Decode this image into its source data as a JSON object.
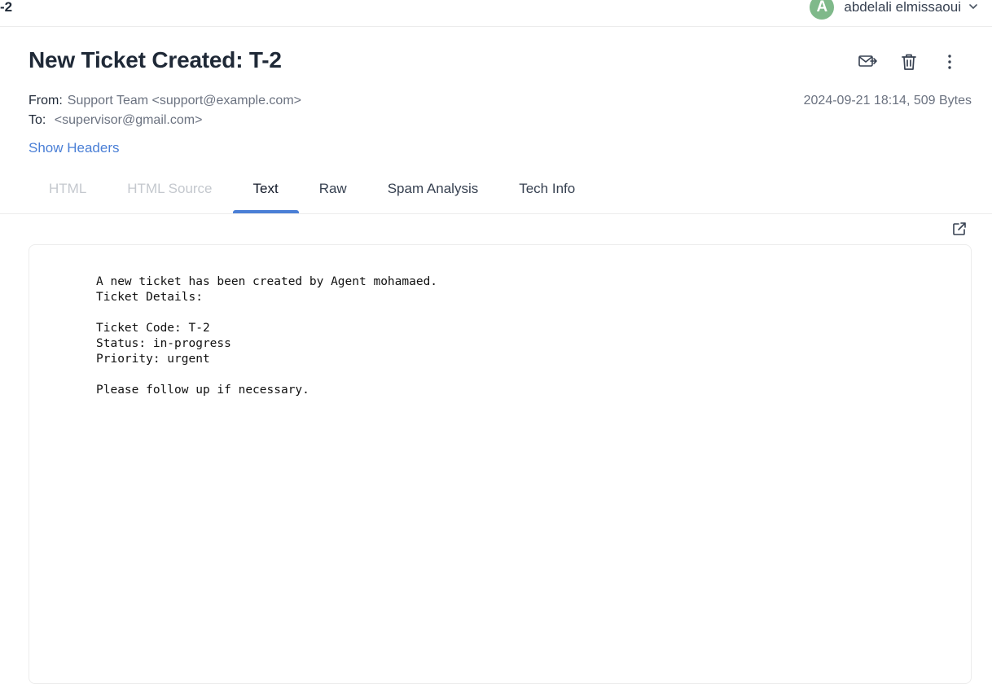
{
  "topbar": {
    "crumb": "-2",
    "user": {
      "avatar_letter": "A",
      "name": "abdelali elmissaoui",
      "menu_icon": "chevron-down-icon"
    }
  },
  "message": {
    "title": "New Ticket Created: T-2",
    "from_label": "From:",
    "from_value": "Support Team <support@example.com>",
    "to_label": "To:",
    "to_value": "<supervisor@gmail.com>",
    "date_size": "2024-09-21 18:14, 509 Bytes",
    "show_headers": "Show Headers",
    "actions": [
      "forward-mail-icon",
      "trash-icon",
      "more-vertical-icon"
    ]
  },
  "tabs": [
    {
      "label": "HTML",
      "state": "disabled"
    },
    {
      "label": "HTML Source",
      "state": "disabled"
    },
    {
      "label": "Text",
      "state": "active"
    },
    {
      "label": "Raw",
      "state": "normal"
    },
    {
      "label": "Spam Analysis",
      "state": "normal"
    },
    {
      "label": "Tech Info",
      "state": "normal"
    }
  ],
  "body": {
    "lines": [
      "A new ticket has been created by Agent mohamaed.",
      "Ticket Details:",
      "",
      "Ticket Code: T-2",
      "Status: in-progress",
      "Priority: urgent",
      "",
      "Please follow up if necessary."
    ]
  },
  "colors": {
    "accent": "#4a7fd6",
    "avatar": "#7fb98a",
    "muted_text": "#6b7280",
    "disabled_tab": "#c4c8ce"
  }
}
